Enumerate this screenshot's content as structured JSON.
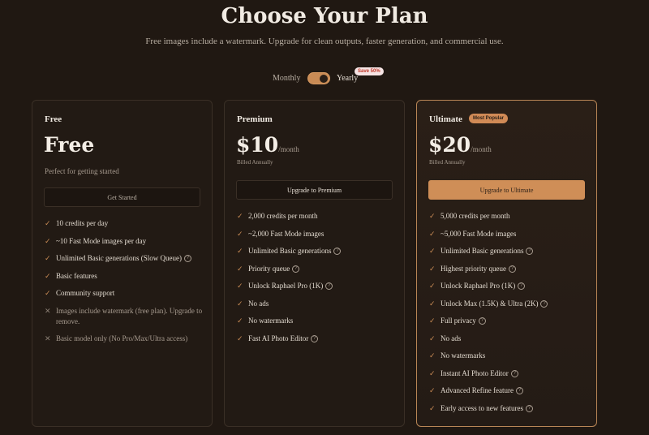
{
  "header": {
    "title": "Choose Your Plan",
    "subtitle": "Free images include a watermark. Upgrade for clean outputs, faster generation, and commercial use."
  },
  "billing_toggle": {
    "monthly_label": "Monthly",
    "yearly_label": "Yearly",
    "save_badge": "Save 50%",
    "selected": "Yearly"
  },
  "plans": [
    {
      "name": "Free",
      "price": "Free",
      "tagline": "Perfect for getting started",
      "cta": "Get Started",
      "features": [
        {
          "text": "10 credits per day",
          "included": true,
          "help": false
        },
        {
          "text": "~10 Fast Mode images per day",
          "included": true,
          "help": false
        },
        {
          "text": "Unlimited Basic generations (Slow Queue)",
          "included": true,
          "help": true
        },
        {
          "text": "Basic features",
          "included": true,
          "help": false
        },
        {
          "text": "Community support",
          "included": true,
          "help": false
        },
        {
          "text": "Images include watermark (free plan). Upgrade to remove.",
          "included": false,
          "help": false
        },
        {
          "text": "Basic model only (No Pro/Max/Ultra access)",
          "included": false,
          "help": false
        }
      ]
    },
    {
      "name": "Premium",
      "price": "$10",
      "period": "/month",
      "billed": "Billed Annually",
      "cta": "Upgrade to Premium",
      "features": [
        {
          "text": "2,000 credits per month",
          "included": true,
          "help": false
        },
        {
          "text": "~2,000 Fast Mode images",
          "included": true,
          "help": false
        },
        {
          "text": "Unlimited Basic generations",
          "included": true,
          "help": true
        },
        {
          "text": "Priority queue",
          "included": true,
          "help": true
        },
        {
          "text": "Unlock Raphael Pro (1K)",
          "included": true,
          "help": true
        },
        {
          "text": "No ads",
          "included": true,
          "help": false
        },
        {
          "text": "No watermarks",
          "included": true,
          "help": false
        },
        {
          "text": "Fast AI Photo Editor",
          "included": true,
          "help": true
        }
      ]
    },
    {
      "name": "Ultimate",
      "badge": "Most Popular",
      "price": "$20",
      "period": "/month",
      "billed": "Billed Annually",
      "cta": "Upgrade to Ultimate",
      "features": [
        {
          "text": "5,000 credits per month",
          "included": true,
          "help": false
        },
        {
          "text": "~5,000 Fast Mode images",
          "included": true,
          "help": false
        },
        {
          "text": "Unlimited Basic generations",
          "included": true,
          "help": true
        },
        {
          "text": "Highest priority queue",
          "included": true,
          "help": true
        },
        {
          "text": "Unlock Raphael Pro (1K)",
          "included": true,
          "help": true
        },
        {
          "text": "Unlock Max (1.5K) & Ultra (2K)",
          "included": true,
          "help": true
        },
        {
          "text": "Full privacy",
          "included": true,
          "help": true
        },
        {
          "text": "No ads",
          "included": true,
          "help": false
        },
        {
          "text": "No watermarks",
          "included": true,
          "help": false
        },
        {
          "text": "Instant AI Photo Editor",
          "included": true,
          "help": true
        },
        {
          "text": "Advanced Refine feature",
          "included": true,
          "help": true
        },
        {
          "text": "Early access to new features",
          "included": true,
          "help": true
        }
      ]
    }
  ],
  "colors": {
    "background": "#201812",
    "accent": "#cf8e57",
    "badge_red": "#c0392b"
  },
  "icons": {
    "included": "check-icon",
    "excluded": "cross-icon",
    "help": "help-circle-icon"
  }
}
